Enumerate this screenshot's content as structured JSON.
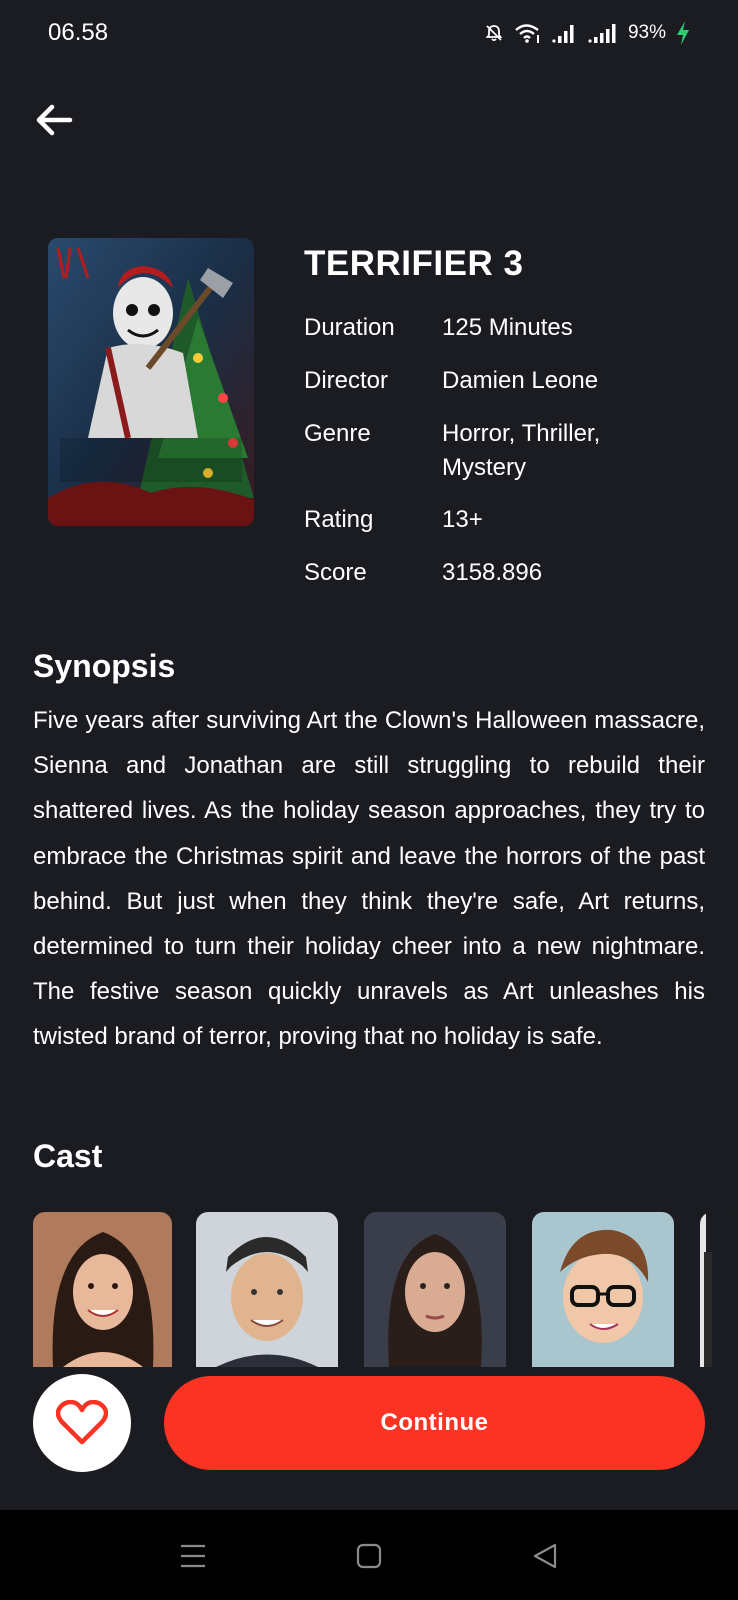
{
  "status_bar": {
    "time": "06.58",
    "battery": "93%"
  },
  "icons": {
    "back": "arrow-left-icon",
    "favorite": "heart-icon",
    "menu": "menu-icon",
    "home": "home-icon",
    "nav_back": "triangle-back-icon"
  },
  "movie": {
    "title": "TERRIFIER 3",
    "poster_alt": "Terrifier 3 poster",
    "details": [
      {
        "label": "Duration",
        "value": "125 Minutes"
      },
      {
        "label": "Director",
        "value": "Damien Leone"
      },
      {
        "label": "Genre",
        "value": "Horror, Thriller, Mystery"
      },
      {
        "label": "Rating",
        "value": "13+"
      },
      {
        "label": "Score",
        "value": "3158.896"
      }
    ]
  },
  "synopsis": {
    "heading": "Synopsis",
    "text": "Five years after surviving Art the Clown's Halloween massacre, Sienna and Jonathan are still struggling to rebuild their shattered lives. As the holiday season approaches, they try to embrace the Christmas spirit and leave the horrors of the past behind. But just when they think they're safe, Art returns, determined to turn their holiday cheer into a new nightmare. The festive season quickly unravels as Art unleashes his twisted brand of terror, proving that no holiday is safe."
  },
  "cast": {
    "heading": "Cast"
  },
  "actions": {
    "continue_label": "Continue"
  },
  "colors": {
    "background": "#1b1c21",
    "accent": "#fb3322",
    "nav_bar": "#000000"
  }
}
